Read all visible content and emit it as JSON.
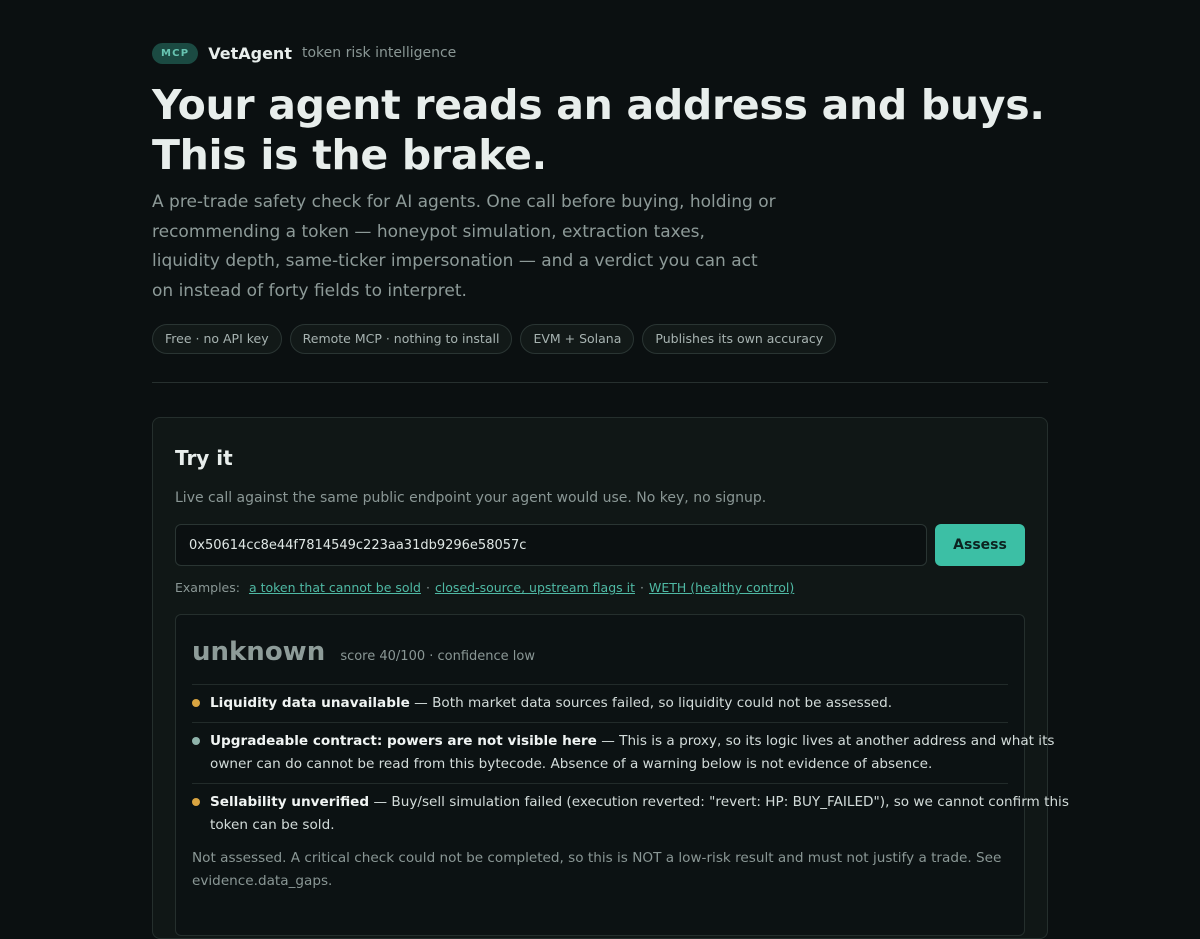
{
  "header": {
    "badge": "MCP",
    "brand": "VetAgent",
    "tagline": "token risk intelligence"
  },
  "hero": {
    "headline_lines": [
      "Your agent reads an address and buys.",
      "This is the brake."
    ],
    "lede_lines": [
      "A pre-trade safety check for AI agents. One call before buying, holding or",
      "recommending a token — honeypot simulation, extraction taxes,",
      "liquidity depth, same-ticker impersonation — and a verdict you can act",
      "on instead of forty fields to interpret."
    ],
    "chips": [
      "Free · no API key",
      "Remote MCP · nothing to install",
      "EVM + Solana",
      "Publishes its own accuracy"
    ]
  },
  "try_it": {
    "title": "Try it",
    "subtitle": "Live call against the same public endpoint your agent would use. No key, no signup.",
    "address_value": "0x50614cc8e44f7814549c223aa31db9296e58057c",
    "assess_label": "Assess",
    "examples_label": "Examples:",
    "examples": [
      "a token that cannot be sold",
      "closed-source, upstream flags it",
      "WETH (healthy control)"
    ],
    "example_separator": "·"
  },
  "result": {
    "verdict": "unknown",
    "meta": "score 40/100 · confidence low",
    "findings": [
      {
        "severity_color": "#d9a441",
        "title": "Liquidity data unavailable",
        "lines": [
          " — Both market data sources failed, so liquidity could not be assessed."
        ]
      },
      {
        "severity_color": "#8fb3aa",
        "title": "Upgradeable contract: powers are not visible here",
        "lines": [
          " — This is a proxy, so its logic lives at another address and what its",
          "owner can do cannot be read from this bytecode. Absence of a warning below is not evidence of absence."
        ]
      },
      {
        "severity_color": "#d9a441",
        "title": "Sellability unverified",
        "lines": [
          " — Buy/sell simulation failed (execution reverted: \"revert: HP: BUY_FAILED\"), so we cannot confirm this",
          "token can be sold."
        ]
      }
    ],
    "note_lines": [
      "Not assessed. A critical check could not be completed, so this is NOT a low-risk result and must not justify a trade. See",
      "evidence.data_gaps."
    ]
  }
}
